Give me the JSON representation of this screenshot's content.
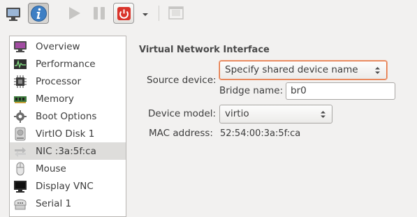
{
  "toolbar": {
    "buttons": [
      {
        "name": "console",
        "icon": "monitor-icon",
        "state": "normal"
      },
      {
        "name": "details",
        "icon": "info-icon",
        "state": "active"
      },
      {
        "name": "run",
        "icon": "play-icon",
        "state": "disabled"
      },
      {
        "name": "pause",
        "icon": "pause-icon",
        "state": "disabled"
      },
      {
        "name": "shutdown",
        "icon": "power-icon",
        "state": "normal"
      },
      {
        "name": "shutdown-menu",
        "icon": "dropdown-arrow-icon",
        "state": "normal"
      },
      {
        "name": "fullscreen",
        "icon": "fullscreen-icon",
        "state": "disabled"
      }
    ]
  },
  "hardware_list": {
    "items": [
      {
        "label": "Overview",
        "icon": "overview-icon"
      },
      {
        "label": "Performance",
        "icon": "performance-icon"
      },
      {
        "label": "Processor",
        "icon": "processor-icon"
      },
      {
        "label": "Memory",
        "icon": "memory-icon"
      },
      {
        "label": "Boot Options",
        "icon": "gear-icon"
      },
      {
        "label": "VirtIO Disk 1",
        "icon": "disk-icon"
      },
      {
        "label": "NIC :3a:5f:ca",
        "icon": "network-icon",
        "selected": true
      },
      {
        "label": "Mouse",
        "icon": "mouse-icon"
      },
      {
        "label": "Display VNC",
        "icon": "display-icon"
      },
      {
        "label": "Serial 1",
        "icon": "serial-icon"
      }
    ]
  },
  "details": {
    "section_title": "Virtual Network Interface",
    "source_device_label": "Source device:",
    "source_device_value": "Specify shared device name",
    "bridge_name_label": "Bridge name:",
    "bridge_name_value": "br0",
    "device_model_label": "Device model:",
    "device_model_value": "virtio",
    "mac_address_label": "MAC address:",
    "mac_address_value": "52:54:00:3a:5f:ca"
  },
  "colors": {
    "window_bg": "#f2f1f0",
    "focus_border": "#e2703e",
    "info_blue": "#3e7fc4",
    "power_red": "#d9342b",
    "selected_row": "#dedddb"
  }
}
